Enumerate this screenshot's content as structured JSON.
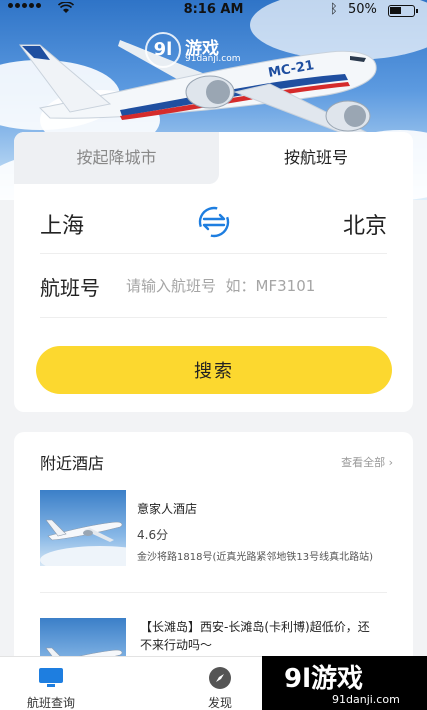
{
  "status_bar": {
    "time": "8:16 AM",
    "battery": "50%"
  },
  "hero": {
    "watermark_badge": "9l",
    "watermark_text": "游戏",
    "watermark_url": "91danji.com",
    "plane_label": "MC-21"
  },
  "search": {
    "tabs": [
      {
        "label": "按起降城市",
        "active": false
      },
      {
        "label": "按航班号",
        "active": true
      }
    ],
    "from_city": "上海",
    "to_city": "北京",
    "swap_icon": "swap-arrows-icon",
    "flight_label": "航班号",
    "flight_placeholder": "请输入航班号  如：MF3101",
    "search_button": "搜索",
    "accent_color": "#fcd82f",
    "icon_color": "#1e7ee0"
  },
  "hotels": {
    "title": "附近酒店",
    "view_all": "查看全部 ›",
    "items": [
      {
        "name": "意家人酒店",
        "score": "4.6分",
        "address": "金沙将路1818号(近真光路紧邻地铁13号线真北路站)"
      },
      {
        "desc": "【长滩岛】西安-长滩岛(卡利博)超低价，还不来行动吗～"
      }
    ]
  },
  "bottom_nav": [
    {
      "label": "航班查询",
      "icon": "monitor-icon",
      "active": true
    },
    {
      "label": "发现",
      "icon": "compass-icon",
      "active": false
    }
  ],
  "watermark_bottom": {
    "text": "9l游戏",
    "url": "91danji.com"
  }
}
